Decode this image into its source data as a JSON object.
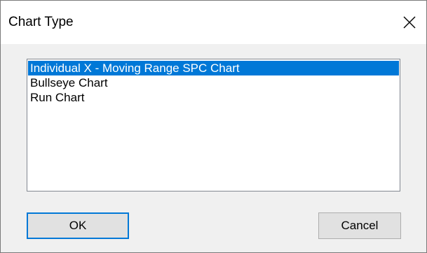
{
  "dialog": {
    "title": "Chart Type",
    "close_glyph": "close-icon"
  },
  "listbox": {
    "items": [
      {
        "label": "Individual X - Moving Range SPC Chart",
        "selected": true
      },
      {
        "label": "Bullseye Chart",
        "selected": false
      },
      {
        "label": "Run Chart",
        "selected": false
      }
    ]
  },
  "buttons": {
    "ok_label": "OK",
    "cancel_label": "Cancel"
  },
  "colors": {
    "selection": "#0078d7",
    "dialog_bg": "#f0f0f0",
    "titlebar_bg": "#ffffff",
    "button_bg": "#e1e1e1"
  }
}
